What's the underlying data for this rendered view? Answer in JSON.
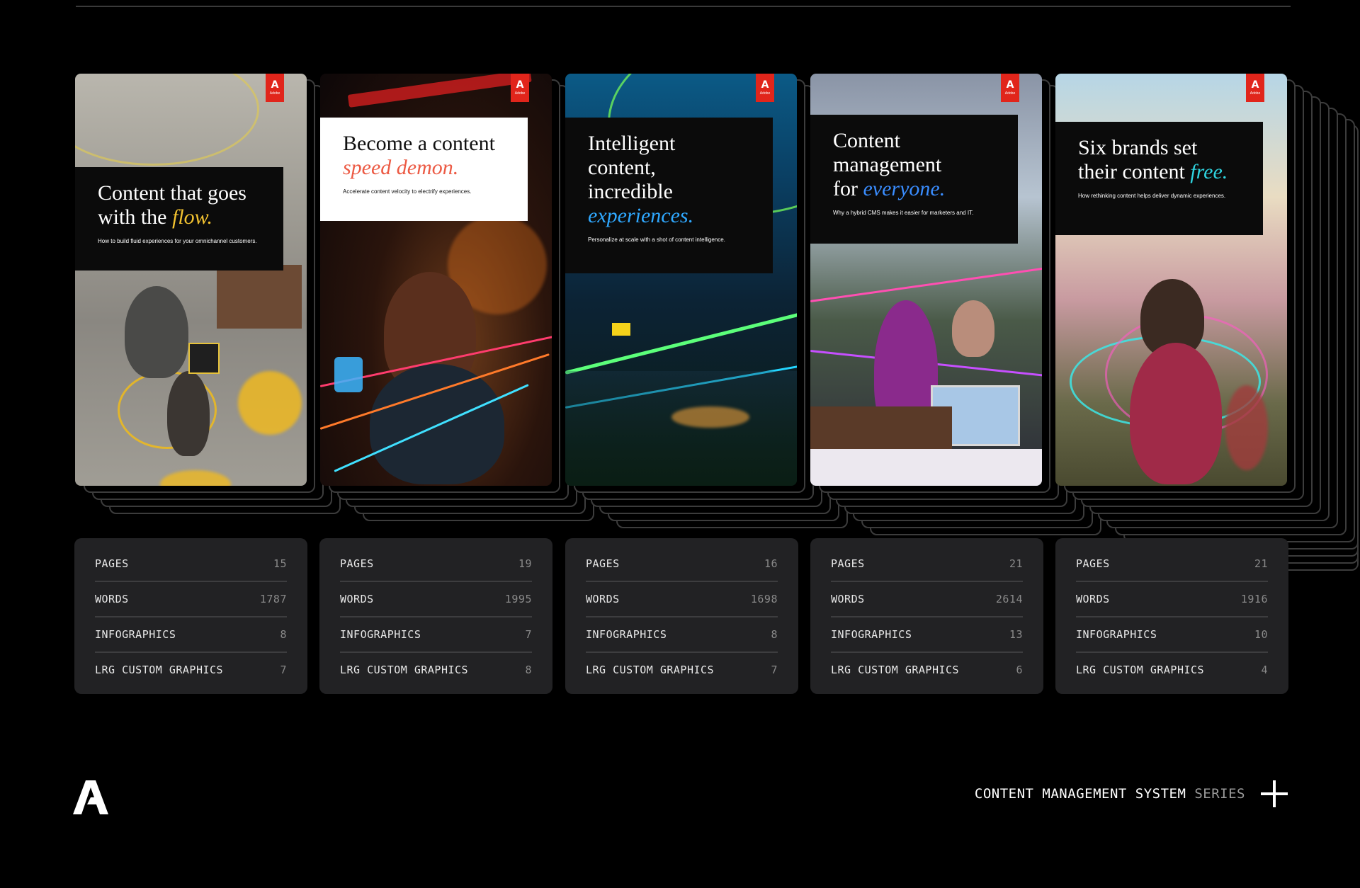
{
  "covers": [
    {
      "title_main": "Content that goes\nwith the ",
      "title_emph": "flow.",
      "emph_color": "#f2c230",
      "subtitle": "How to build fluid experiences for your omnichannel customers.",
      "logo_glyph": "A",
      "logo_word": "Adobe"
    },
    {
      "title_main": "Become a content\n",
      "title_emph": "speed demon.",
      "emph_color": "#ec5a44",
      "subtitle": "Accelerate content velocity to electrify experiences.",
      "logo_glyph": "A",
      "logo_word": "Adobe"
    },
    {
      "title_main": "Intelligent\ncontent,\nincredible\n",
      "title_emph": "experiences.",
      "emph_color": "#2fa8ff",
      "subtitle": "Personalize at scale with a shot of content intelligence.",
      "logo_glyph": "A",
      "logo_word": "Adobe"
    },
    {
      "title_main": "Content\nmanagement\nfor ",
      "title_emph": "everyone.",
      "emph_color": "#3a8dff",
      "subtitle": "Why a hybrid CMS makes it easier for marketers and IT.",
      "logo_glyph": "A",
      "logo_word": "Adobe"
    },
    {
      "title_main": "Six brands set\ntheir content ",
      "title_emph": "free.",
      "emph_color": "#2fd4e0",
      "subtitle": "How rethinking content helps deliver dynamic experiences.",
      "logo_glyph": "A",
      "logo_word": "Adobe"
    }
  ],
  "stats": [
    {
      "pages_label": "PAGES",
      "pages": "15",
      "words_label": "WORDS",
      "words": "1787",
      "info_label": "INFOGRAPHICS",
      "info": "8",
      "lrg_label": "LRG CUSTOM GRAPHICS",
      "lrg": "7"
    },
    {
      "pages_label": "PAGES",
      "pages": "19",
      "words_label": "WORDS",
      "words": "1995",
      "info_label": "INFOGRAPHICS",
      "info": "7",
      "lrg_label": "LRG CUSTOM GRAPHICS",
      "lrg": "8"
    },
    {
      "pages_label": "PAGES",
      "pages": "16",
      "words_label": "WORDS",
      "words": "1698",
      "info_label": "INFOGRAPHICS",
      "info": "8",
      "lrg_label": "LRG CUSTOM GRAPHICS",
      "lrg": "7"
    },
    {
      "pages_label": "PAGES",
      "pages": "21",
      "words_label": "WORDS",
      "words": "2614",
      "info_label": "INFOGRAPHICS",
      "info": "13",
      "lrg_label": "LRG CUSTOM GRAPHICS",
      "lrg": "6"
    },
    {
      "pages_label": "PAGES",
      "pages": "21",
      "words_label": "WORDS",
      "words": "1916",
      "info_label": "INFOGRAPHICS",
      "info": "10",
      "lrg_label": "LRG CUSTOM GRAPHICS",
      "lrg": "4"
    }
  ],
  "footer": {
    "series_main": "CONTENT MANAGEMENT SYSTEM",
    "series_tail": "SERIES",
    "plus_icon": "plus-icon",
    "logo_icon": "adobe-logo-icon"
  },
  "colors": {
    "background": "#000000",
    "panel": "#222224",
    "adobe_red": "#e1251b"
  }
}
